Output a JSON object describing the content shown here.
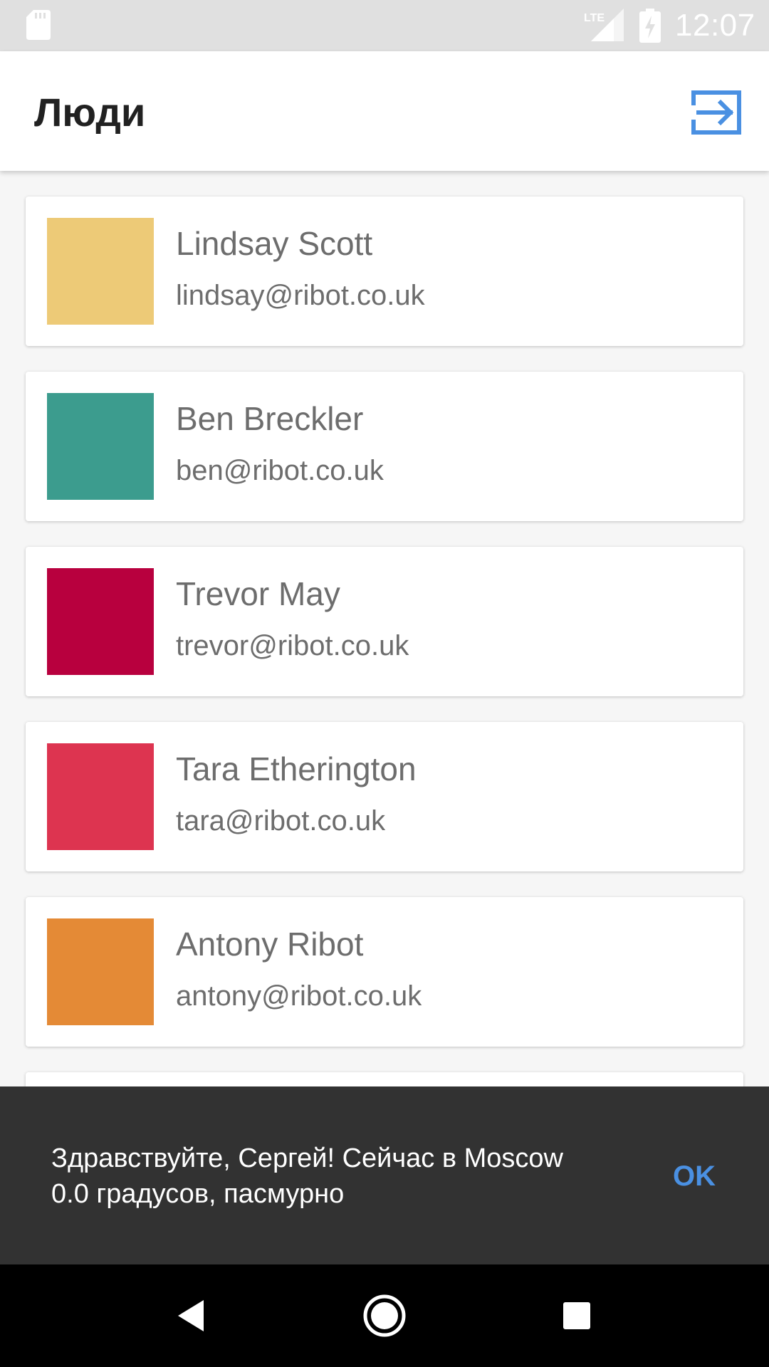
{
  "status_bar": {
    "time": "12:07",
    "network_label": "LTE",
    "icons": [
      "sd-card-icon",
      "lte-signal-icon",
      "battery-charging-icon"
    ]
  },
  "app_bar": {
    "title": "Люди",
    "action_icon": "logout-icon",
    "accent_color": "#4a90e2"
  },
  "people": [
    {
      "name": "Lindsay Scott",
      "email": "lindsay@ribot.co.uk",
      "color": "#edca77"
    },
    {
      "name": "Ben Breckler",
      "email": "ben@ribot.co.uk",
      "color": "#3c9c8e"
    },
    {
      "name": "Trevor May",
      "email": "trevor@ribot.co.uk",
      "color": "#b8003e"
    },
    {
      "name": "Tara Etherington",
      "email": "tara@ribot.co.uk",
      "color": "#dd3450"
    },
    {
      "name": "Antony Ribot",
      "email": "antony@ribot.co.uk",
      "color": "#e48a36"
    },
    {
      "name": "",
      "email": "",
      "color": "#ffffff"
    }
  ],
  "snackbar": {
    "message": "Здравствуйте, Сергей! Сейчас в Moscow 0.0 градусов, пасмурно",
    "action_label": "OK"
  },
  "nav_bar": {
    "icons": [
      "back-icon",
      "home-icon",
      "recents-icon"
    ]
  }
}
